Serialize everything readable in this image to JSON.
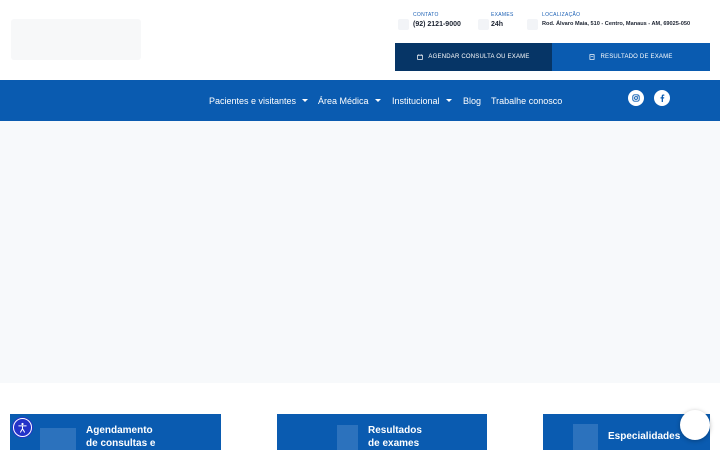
{
  "topbar": {
    "contato": {
      "label": "CONTATO",
      "value": "(92) 2121-9000"
    },
    "exames": {
      "label": "EXAMES",
      "value": "24h"
    },
    "localizacao": {
      "label": "LOCALIZAÇÃO",
      "value": "Rod. Álvaro Maia, 510 - Centro, Manaus - AM, 69025-050"
    },
    "buttons": {
      "agendar": "AGENDAR CONSULTA OU EXAME",
      "resultado": "RESULTADO DE EXAME"
    }
  },
  "nav": {
    "items": [
      {
        "label": "Pacientes e visitantes"
      },
      {
        "label": "Área Médica"
      },
      {
        "label": "Institucional"
      },
      {
        "label": "Blog"
      },
      {
        "label": "Trabalhe conosco"
      }
    ],
    "social": [
      "instagram-icon",
      "facebook-icon"
    ]
  },
  "cards": [
    {
      "line1": "Agendamento",
      "line2": "de consultas e"
    },
    {
      "line1": "Resultados",
      "line2": "de exames"
    },
    {
      "line1": "Especialidades",
      "line2": ""
    }
  ],
  "colors": {
    "primary": "#0a5bb0",
    "dark": "#063566",
    "accessibility": "#2433c9"
  }
}
